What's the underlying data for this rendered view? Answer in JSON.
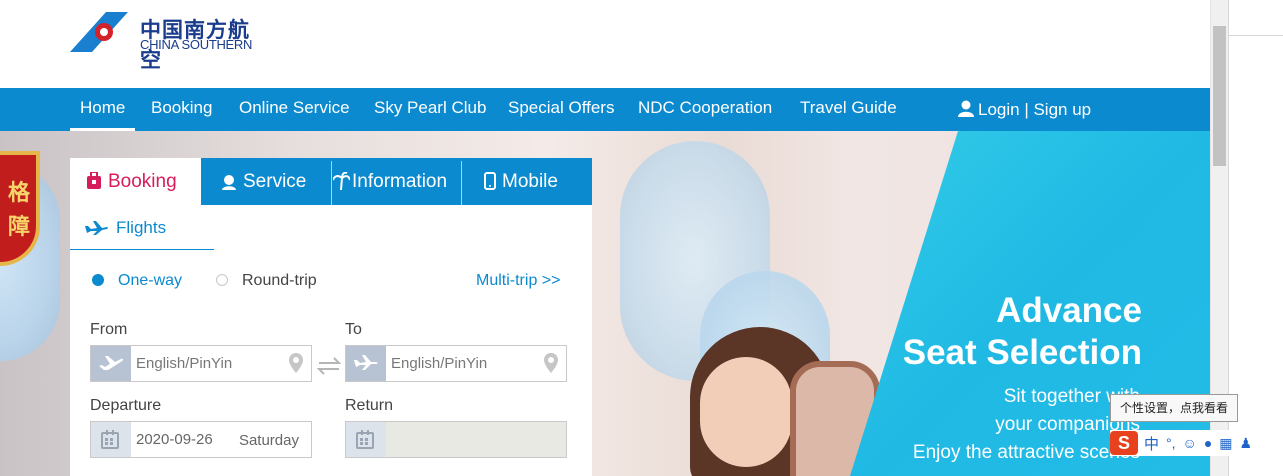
{
  "header": {
    "logo_cn": "中国南方航空",
    "logo_en": "CHINA SOUTHERN"
  },
  "nav": {
    "items": [
      "Home",
      "Booking",
      "Online Service",
      "Sky Pearl Club",
      "Special Offers",
      "NDC Cooperation",
      "Travel Guide"
    ],
    "login_label": "Login | Sign up"
  },
  "booking": {
    "tabs": [
      "Booking",
      "Service",
      "Information",
      "Mobile"
    ],
    "subtab": "Flights",
    "trip_types": [
      "One-way",
      "Round-trip"
    ],
    "multi_trip": "Multi-trip >>",
    "from_label": "From",
    "to_label": "To",
    "from_placeholder": "English/PinYin",
    "to_placeholder": "English/PinYin",
    "departure_label": "Departure",
    "return_label": "Return",
    "departure_date": "2020-09-26",
    "departure_day": "Saturday"
  },
  "promo": {
    "title_line1": "Advance",
    "title_line2": "Seat Selection",
    "sub_line1": "Sit together with",
    "sub_line2": "your companions",
    "sub_line3": "Enjoy the attractive scenes"
  },
  "badge": {
    "line1": "格",
    "line2": "障"
  },
  "ime": {
    "tooltip": "个性设置，点我看看",
    "mode": "中"
  },
  "colors": {
    "nav_blue": "#0b8ad0",
    "accent_red": "#d61d5a",
    "promo_cyan": "#23bce7"
  }
}
